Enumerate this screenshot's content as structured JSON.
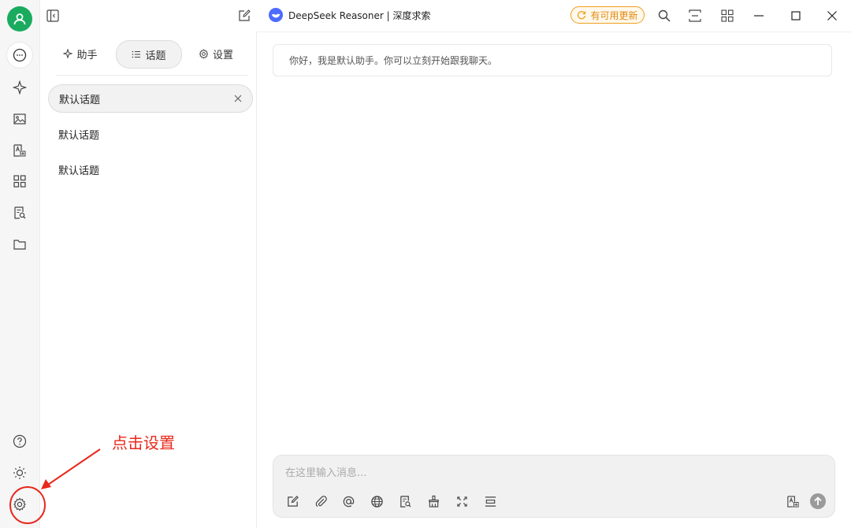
{
  "titlebar": {
    "model_name": "DeepSeek Reasoner | 深度求索",
    "update_label": "有可用更新"
  },
  "tabs": [
    {
      "label": "助手",
      "icon": "sparkle-icon"
    },
    {
      "label": "话题",
      "icon": "list-icon"
    },
    {
      "label": "设置",
      "icon": "gear-icon"
    }
  ],
  "topics": [
    {
      "label": "默认话题"
    },
    {
      "label": "默认话题"
    },
    {
      "label": "默认话题"
    }
  ],
  "chat": {
    "welcome_message": "你好，我是默认助手。你可以立刻开始跟我聊天。",
    "input_placeholder": "在这里输入消息..."
  },
  "annotation": {
    "text": "点击设置",
    "color": "#e8291c"
  },
  "colors": {
    "avatar": "#1aab5f",
    "update_badge": "#f0a020",
    "brand_logo": "#4d6bfe"
  }
}
